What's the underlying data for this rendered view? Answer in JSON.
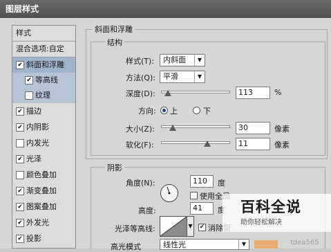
{
  "window": {
    "title": "图层样式"
  },
  "left_panel": {
    "header": "样式",
    "blend_options": "混合选项:自定",
    "items": [
      {
        "label": "斜面和浮雕",
        "checked": true,
        "state": "selected"
      },
      {
        "label": "等高线",
        "checked": true,
        "state": "sub"
      },
      {
        "label": "纹理",
        "checked": false,
        "state": "sub"
      },
      {
        "label": "描边",
        "checked": true
      },
      {
        "label": "内阴影",
        "checked": true
      },
      {
        "label": "内发光",
        "checked": false
      },
      {
        "label": "光泽",
        "checked": true
      },
      {
        "label": "颜色叠加",
        "checked": false
      },
      {
        "label": "渐变叠加",
        "checked": true
      },
      {
        "label": "图案叠加",
        "checked": true
      },
      {
        "label": "外发光",
        "checked": true
      },
      {
        "label": "投影",
        "checked": true
      }
    ]
  },
  "bevel": {
    "group_title": "斜面和浮雕",
    "structure_title": "结构",
    "style_label": "样式(T):",
    "style_value": "内斜面",
    "technique_label": "方法(Q):",
    "technique_value": "平滑",
    "depth_label": "深度(D):",
    "depth_value": "113",
    "depth_unit": "%",
    "direction_label": "方向:",
    "direction_up": "上",
    "direction_down": "下",
    "direction_selected": "上",
    "size_label": "大小(Z):",
    "size_value": "30",
    "size_unit": "像素",
    "soften_label": "软化(F):",
    "soften_value": "11",
    "soften_unit": "像素"
  },
  "shading": {
    "title": "阴影",
    "angle_label": "角度(N):",
    "angle_value": "110",
    "angle_unit": "度",
    "global_light_label": "使用全局",
    "global_light_checked": false,
    "altitude_label": "高度:",
    "altitude_value": "41",
    "altitude_unit": "度",
    "gloss_contour_label": "光泽等高线:",
    "anti_alias_label": "消除锯",
    "anti_alias_checked": true,
    "highlight_mode_label": "高光模式",
    "highlight_mode_value": "线性光",
    "highlight_color": "#e8ad6c"
  },
  "watermark": {
    "title": "百科全说",
    "subtitle": "助你轻松解决",
    "faint_text": "tdea565"
  }
}
